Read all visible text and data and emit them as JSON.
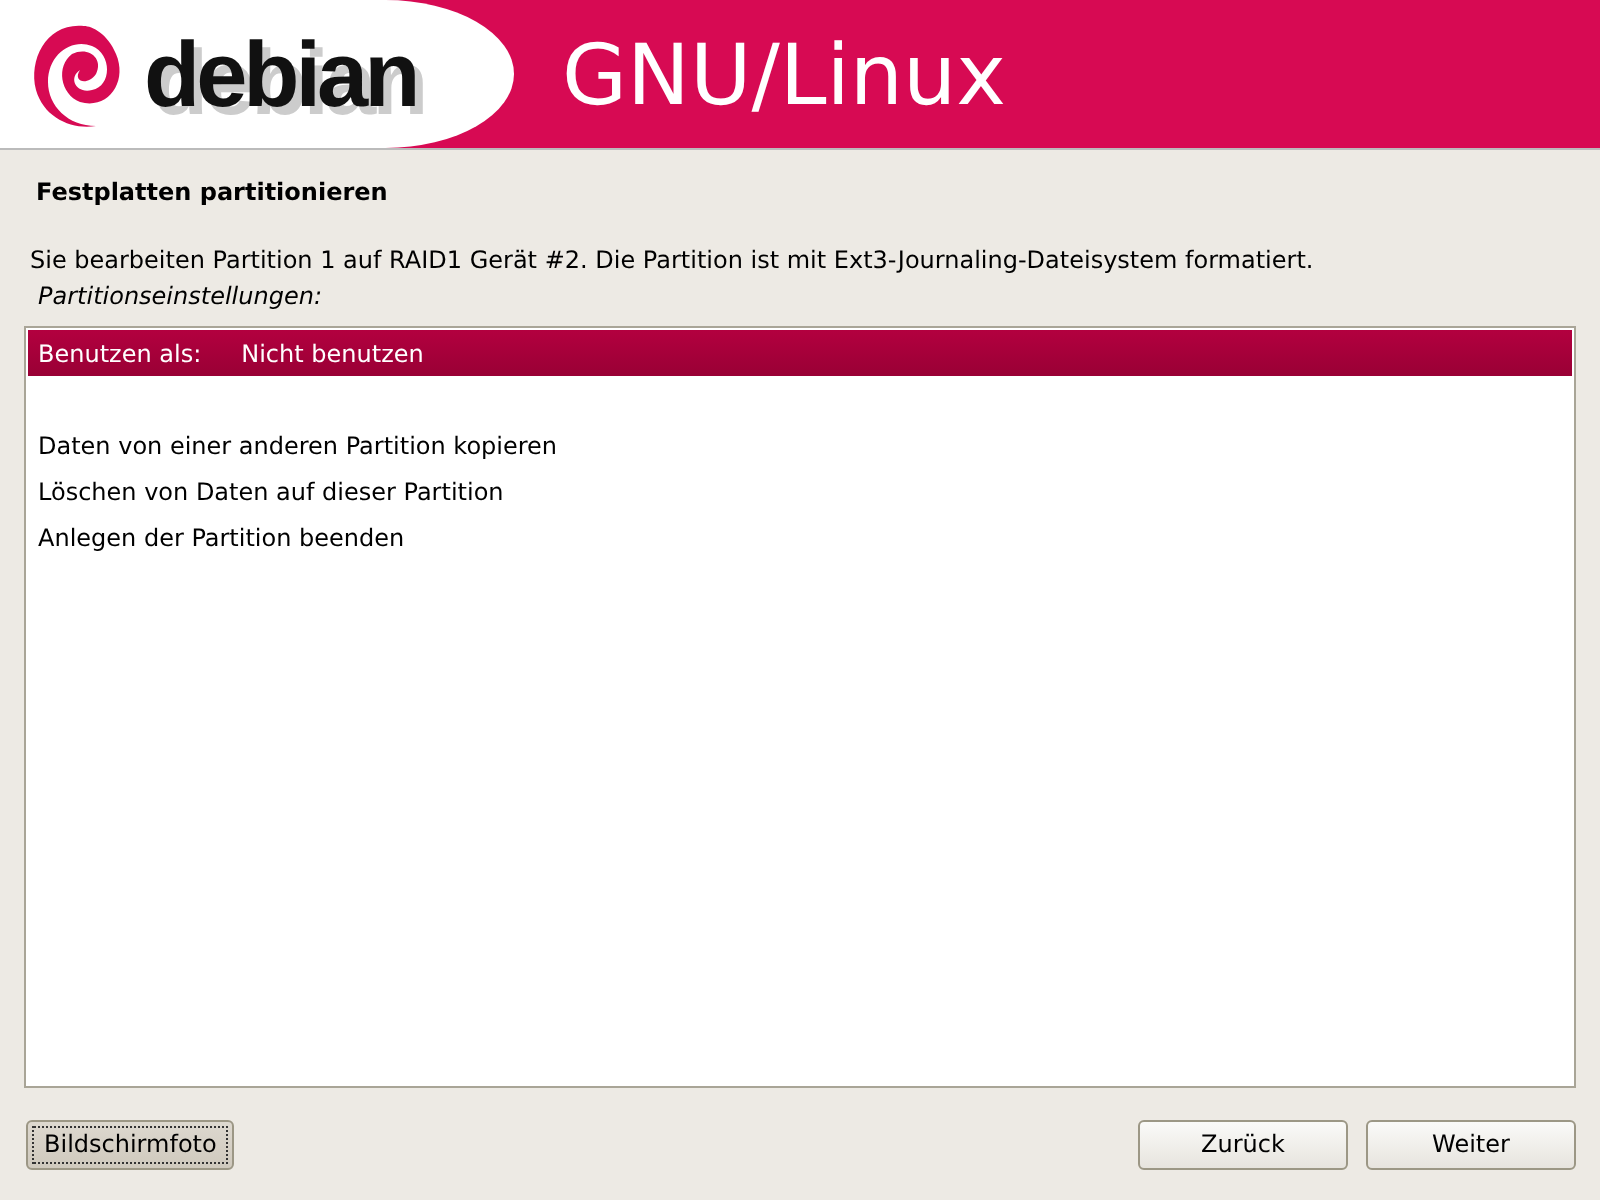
{
  "banner": {
    "logo_text": "debian",
    "title": "GNU/Linux"
  },
  "heading": "Festplatten partitionieren",
  "description": "Sie bearbeiten Partition 1 auf RAID1 Gerät #2. Die Partition ist mit Ext3-Journaling-Dateisystem formatiert.",
  "list_label": "Partitionseinstellungen:",
  "items": [
    {
      "kind": "setting",
      "label": "Benutzen als:",
      "value": "Nicht benutzen",
      "selected": true
    },
    {
      "kind": "blank"
    },
    {
      "kind": "action",
      "label": "Daten von einer anderen Partition kopieren",
      "selected": false
    },
    {
      "kind": "action",
      "label": "Löschen von Daten auf dieser Partition",
      "selected": false
    },
    {
      "kind": "action",
      "label": "Anlegen der Partition beenden",
      "selected": false
    }
  ],
  "buttons_left": [
    {
      "label": "Bildschirmfoto",
      "focused": true
    }
  ],
  "buttons_right": [
    {
      "label": "Zurück",
      "focused": false
    },
    {
      "label": "Weiter",
      "focused": false
    }
  ]
}
